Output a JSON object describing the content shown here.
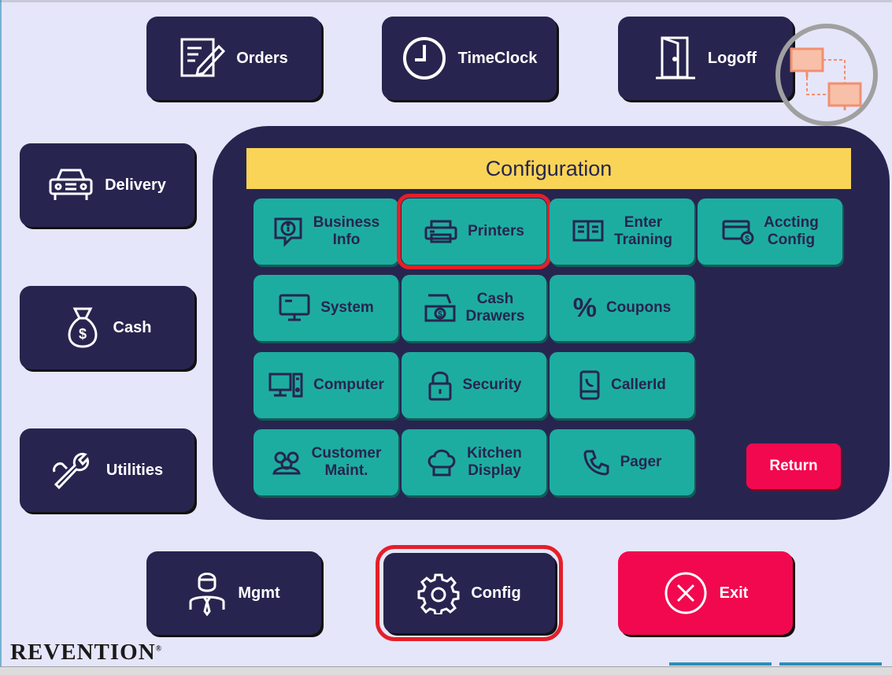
{
  "nav": {
    "orders": "Orders",
    "timeclock": "TimeClock",
    "logoff": "Logoff",
    "delivery": "Delivery",
    "cash": "Cash",
    "utilities": "Utilities",
    "mgmt": "Mgmt",
    "config": "Config",
    "exit": "Exit"
  },
  "config_panel": {
    "title": "Configuration",
    "tiles": [
      {
        "label1": "Business",
        "label2": "Info"
      },
      {
        "label1": "Printers",
        "label2": ""
      },
      {
        "label1": "Enter",
        "label2": "Training"
      },
      {
        "label1": "Accting",
        "label2": "Config"
      },
      {
        "label1": "System",
        "label2": ""
      },
      {
        "label1": "Cash",
        "label2": "Drawers"
      },
      {
        "label1": "Coupons",
        "label2": ""
      },
      {
        "label1": "Computer",
        "label2": ""
      },
      {
        "label1": "Security",
        "label2": ""
      },
      {
        "label1": "CallerId",
        "label2": ""
      },
      {
        "label1": "Customer",
        "label2": "Maint."
      },
      {
        "label1": "Kitchen",
        "label2": "Display"
      },
      {
        "label1": "Pager",
        "label2": ""
      }
    ],
    "return_label": "Return"
  },
  "brand": {
    "logo_text": "REVENTION",
    "registered": "®"
  },
  "colors": {
    "background": "#e6e6fa",
    "navy": "#27254f",
    "teal": "#1dada0",
    "title_bar": "#fad456",
    "exit_red": "#f2084f",
    "highlight_red": "#e41f2a"
  },
  "icons": {
    "orders": "edit-document-icon",
    "timeclock": "clock-icon",
    "logoff": "door-icon",
    "delivery": "car-icon",
    "cash": "money-bag-icon",
    "utilities": "wrench-icon",
    "mgmt": "manager-icon",
    "config": "gear-icon",
    "exit": "close-circle-icon",
    "network": "network-status-icon"
  }
}
